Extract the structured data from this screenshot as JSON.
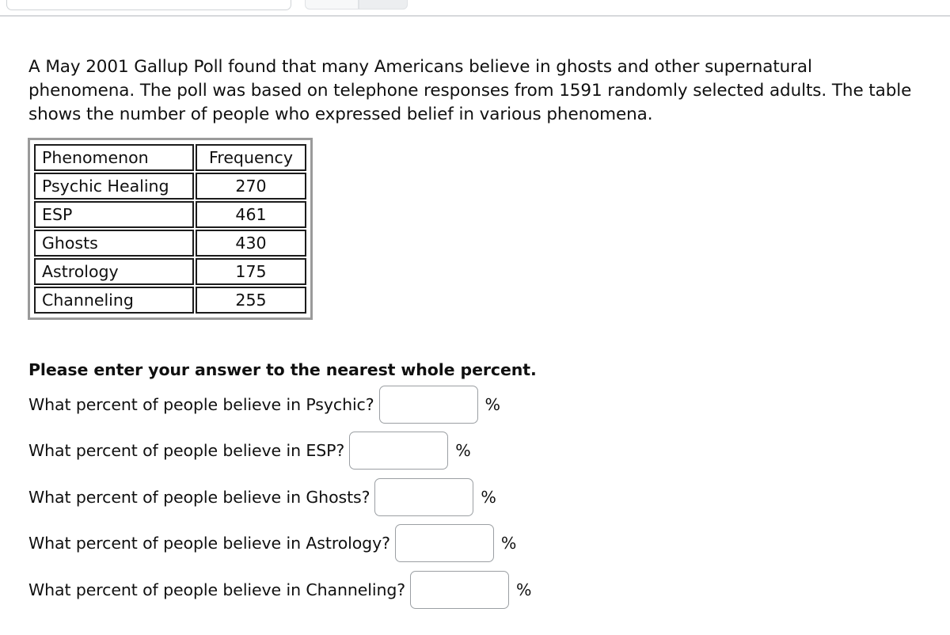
{
  "toolbar": {
    "search_value": "",
    "button_a_label": "",
    "button_b_label": ""
  },
  "intro": {
    "text": "A May 2001 Gallup Poll found that many Americans believe in ghosts and other supernatural phenomena. The poll was based on telephone responses from 1591 randomly selected adults. The table shows the number of people who expressed belief in various phenomena."
  },
  "table": {
    "headers": [
      "Phenomenon",
      "Frequency"
    ],
    "rows": [
      {
        "phenomenon": "Psychic Healing",
        "frequency": "270"
      },
      {
        "phenomenon": "ESP",
        "frequency": "461"
      },
      {
        "phenomenon": "Ghosts",
        "frequency": "430"
      },
      {
        "phenomenon": "Astrology",
        "frequency": "175"
      },
      {
        "phenomenon": "Channeling",
        "frequency": "255"
      }
    ]
  },
  "instruction": "Please enter your answer to the nearest whole percent.",
  "questions": [
    {
      "label": "What percent of people believe in Psychic?",
      "value": "",
      "unit": "%"
    },
    {
      "label": "What percent of people believe in ESP?",
      "value": "",
      "unit": "%"
    },
    {
      "label": "What percent of people believe in Ghosts?",
      "value": "",
      "unit": "%"
    },
    {
      "label": "What percent of people believe in Astrology?",
      "value": "",
      "unit": "%"
    },
    {
      "label": "What percent of people believe in Channeling?",
      "value": "",
      "unit": "%"
    }
  ],
  "chart_data": {
    "type": "table",
    "title": "Belief in supernatural phenomena (May 2001 Gallup Poll)",
    "columns": [
      "Phenomenon",
      "Frequency"
    ],
    "categories": [
      "Psychic Healing",
      "ESP",
      "Ghosts",
      "Astrology",
      "Channeling"
    ],
    "values": [
      270,
      461,
      430,
      175,
      255
    ],
    "xlabel": "Phenomenon",
    "ylabel": "Frequency",
    "total_respondents": 1591
  },
  "colors": {
    "page_background": "#ffffff",
    "text": "#101010",
    "table_cell_border": "#1c1c1c",
    "table_outer_frame": "#9a9a9a",
    "input_border": "#9b9fa3",
    "divider": "#d7d9dc"
  }
}
